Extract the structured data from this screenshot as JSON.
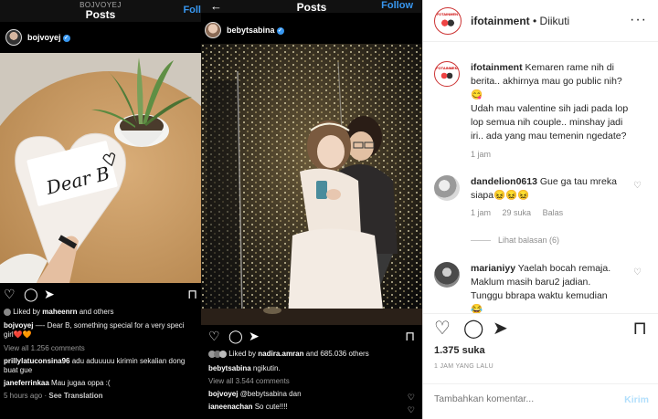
{
  "left_post": {
    "owner": "BOJVOYEJ",
    "title": "Posts",
    "follow": "Foll",
    "username": "bojvoyej",
    "card_text": "Dear B",
    "liked_by_prefix": "Liked by",
    "liked_by_user": "maheenrn",
    "liked_by_suffix": "and others",
    "caption_user": "bojvoyej",
    "caption_text": "—- Dear B, something special for a very speci",
    "caption_cont": "girl❤️🧡",
    "view_comments": "View all 1.256 comments",
    "comments": [
      {
        "user": "prillylatuconsina96",
        "text": "adu aduuuuu kirimin sekalian dong"
      },
      {
        "user": "",
        "text": "buat gue"
      },
      {
        "user": "janeferrinkaa",
        "text": "Mau jugaa oppa :("
      }
    ],
    "time": "5 hours ago",
    "see_translation": "See Translation"
  },
  "middle_post": {
    "title": "Posts",
    "follow": "Follow",
    "username": "bebytsabina",
    "liked_by_prefix": "Liked by",
    "liked_by_user": "nadira.amran",
    "liked_by_suffix": "and 685.036 others",
    "caption_user": "bebytsabina",
    "caption_text": "ngikutin.",
    "view_comments": "View all 3.544 comments",
    "comments": [
      {
        "user": "bojvoyej",
        "text": "@bebytsabina dan"
      },
      {
        "user": "ianeenachan",
        "text": "So cute!!!!"
      }
    ]
  },
  "right_post": {
    "account": "ifotainment",
    "follow_status": "• Diikuti",
    "avatar_label": "IFOTAINMENT",
    "caption": {
      "user": "ifotainment",
      "line1": "Kemaren rame nih di",
      "line2": "berita.. akhirnya mau go public nih?",
      "emoji1": "😋",
      "line3": "Udah mau valentine sih jadi pada lop",
      "line4": "lop semua nih couple.. minshay jadi",
      "line5": "iri.. ada yang mau temenin ngedate?",
      "time": "1 jam"
    },
    "comments": [
      {
        "user": "dandelion0613",
        "text1": "Gue ga tau mreka",
        "text2": "siapa😖😖😖",
        "time": "1 jam",
        "likes": "29 suka",
        "reply": "Balas",
        "view_replies": "Lihat balasan (6)"
      },
      {
        "user": "marianiyy",
        "text1": "Yaelah bocah remaja.",
        "text2": "Maklum masih baru2 jadian.",
        "text3": "Tunggu bbrapa waktu kemudian",
        "emoji": "😂"
      }
    ],
    "likes": "1.375 suka",
    "time_ago": "1 JAM YANG LALU",
    "comment_placeholder": "Tambahkan komentar...",
    "send": "Kirim"
  }
}
